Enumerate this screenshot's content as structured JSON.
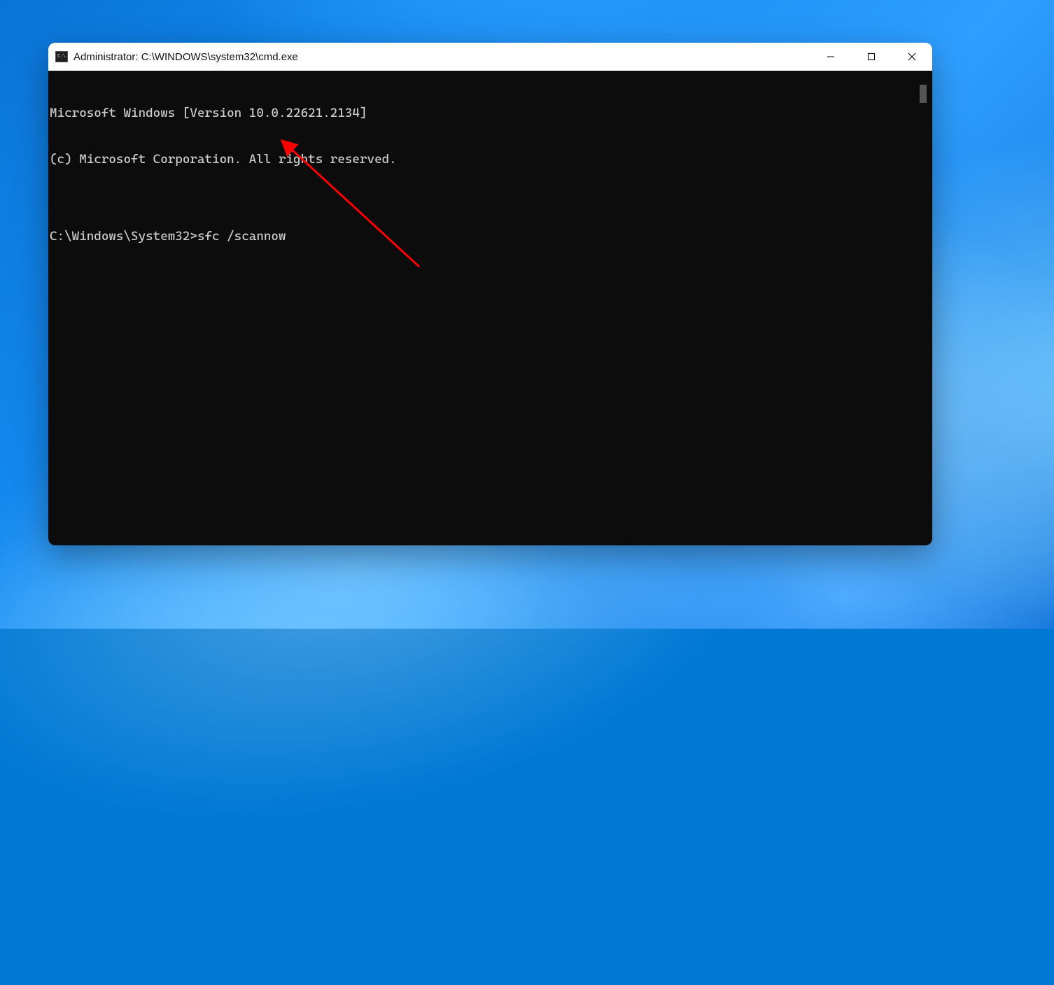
{
  "window": {
    "title": "Administrator: C:\\WINDOWS\\system32\\cmd.exe",
    "app_icon_text": "C:\\."
  },
  "terminal": {
    "line1": "Microsoft Windows [Version 10.0.22621.2134]",
    "line2": "(c) Microsoft Corporation. All rights reserved.",
    "blank": "",
    "prompt": "C:\\Windows\\System32>",
    "command": "sfc /scannow"
  }
}
